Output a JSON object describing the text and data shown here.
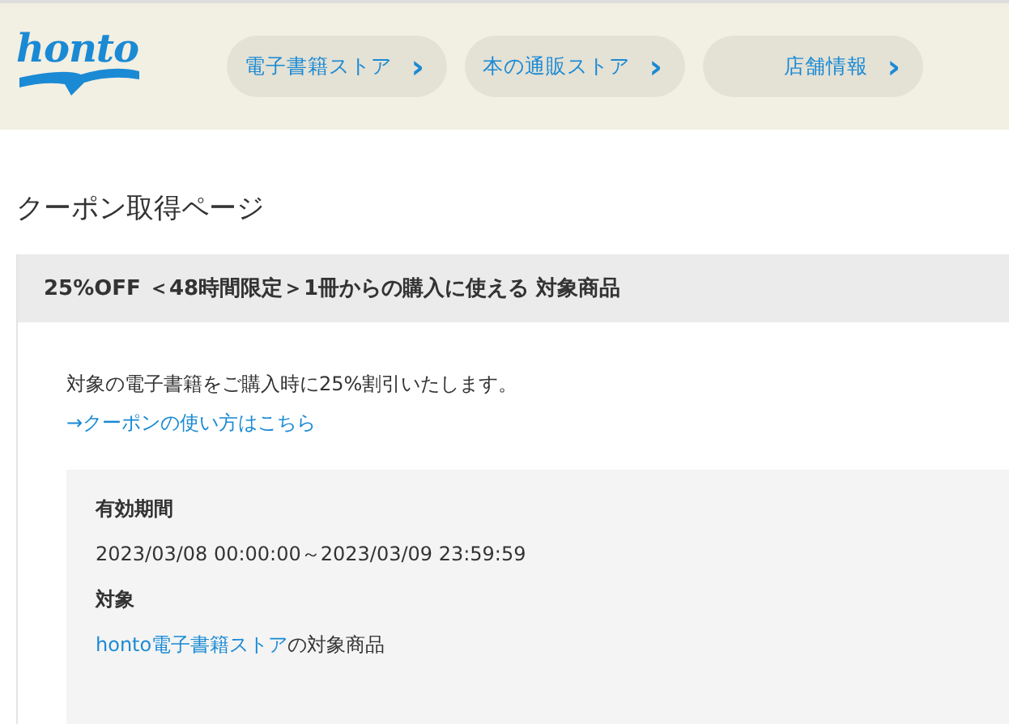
{
  "header": {
    "logo": "honto",
    "nav": [
      {
        "label": "電子書籍ストア",
        "icon": "›"
      },
      {
        "label": "本の通販ストア",
        "icon": "›"
      },
      {
        "label": "店舗情報",
        "icon": "›"
      }
    ]
  },
  "page_title": "クーポン取得ページ",
  "coupon": {
    "title": "25%OFF ＜48時間限定＞1冊からの購入に使える 対象商品",
    "description": "対象の電子書籍をご購入時に25%割引いたします。",
    "help_link": "→クーポンの使い方はこちら",
    "details": [
      {
        "label": "有効期間",
        "value": "2023/03/08 00:00:00～2023/03/09 23:59:59"
      },
      {
        "label": "対象",
        "link": "honto電子書籍ストア",
        "value": "の対象商品"
      }
    ]
  }
}
